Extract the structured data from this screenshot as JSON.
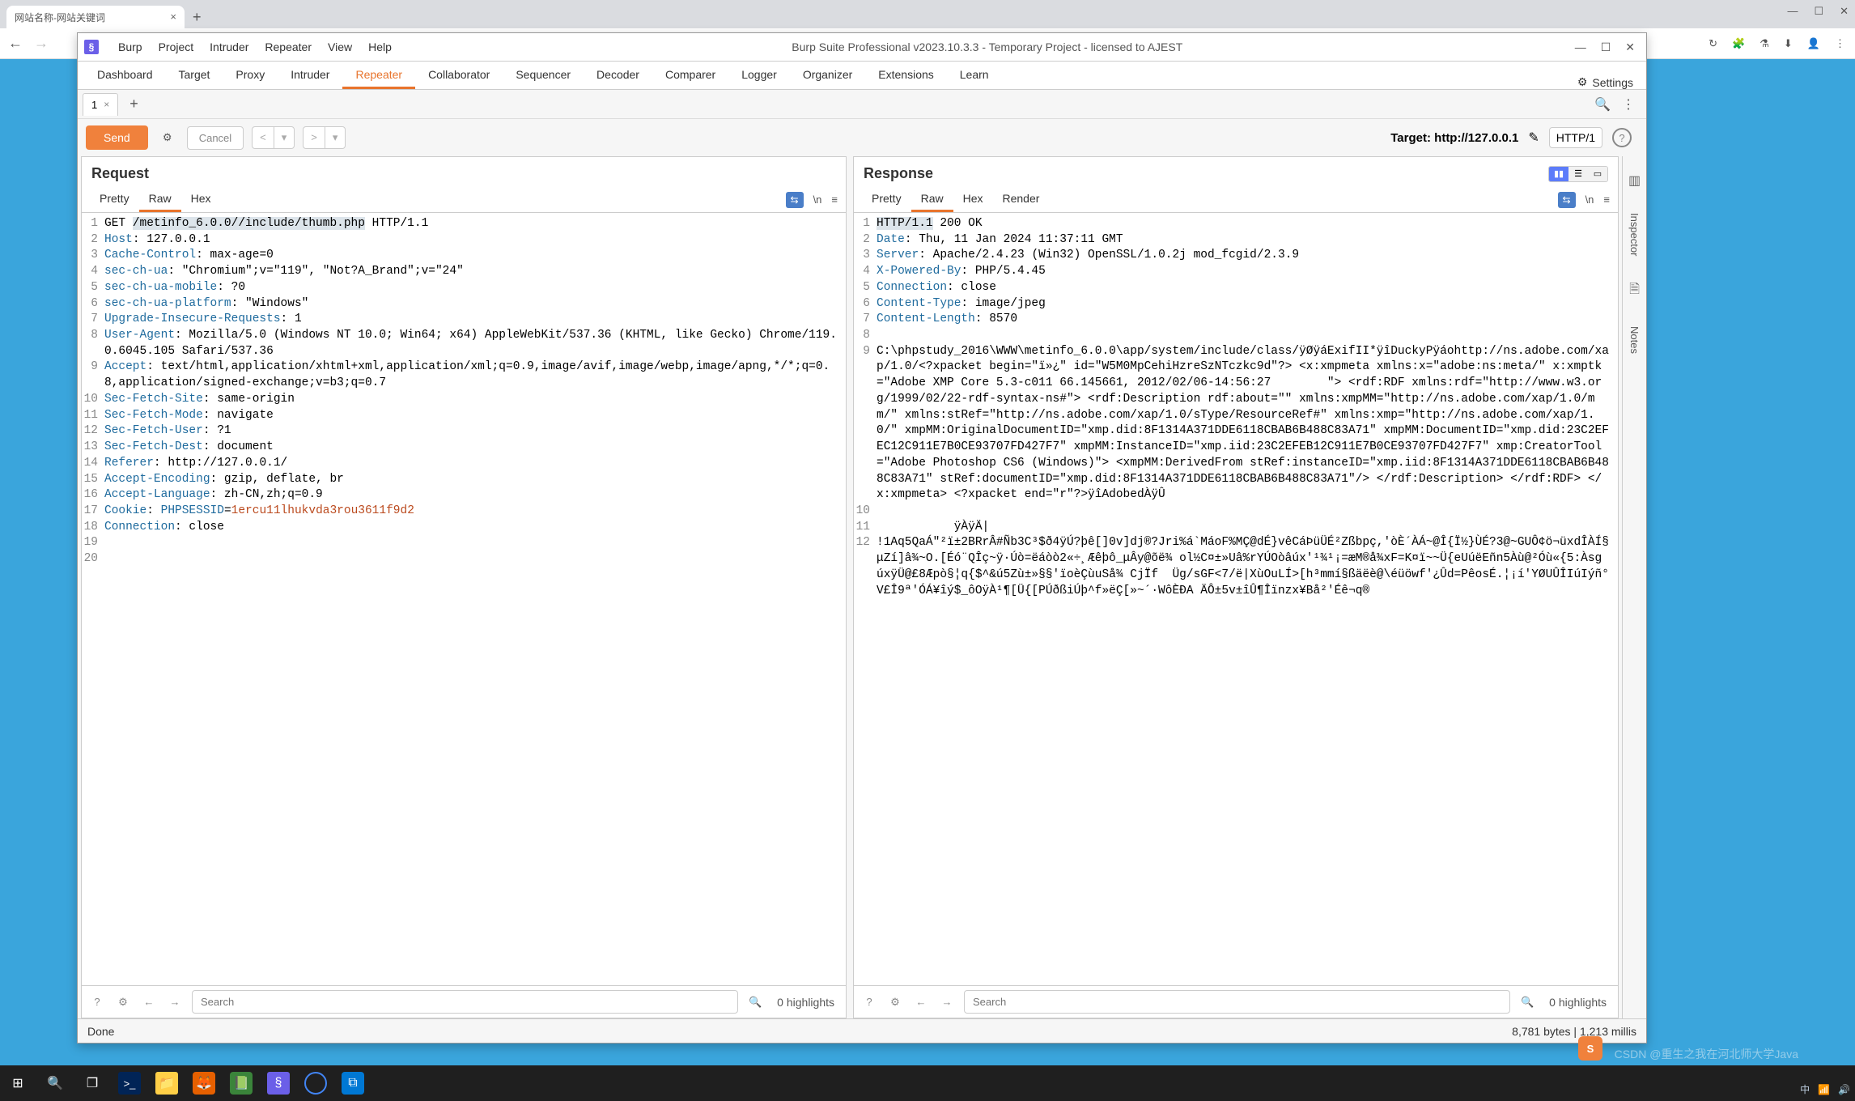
{
  "browser": {
    "tab_title": "网站名称-网站关键词",
    "toolbar_right_icons": [
      "puzzle",
      "flask",
      "download",
      "avatar",
      "kebab"
    ]
  },
  "burp": {
    "menus": [
      "Burp",
      "Project",
      "Intruder",
      "Repeater",
      "View",
      "Help"
    ],
    "title": "Burp Suite Professional v2023.10.3.3 - Temporary Project - licensed to AJEST",
    "tabs": [
      "Dashboard",
      "Target",
      "Proxy",
      "Intruder",
      "Repeater",
      "Collaborator",
      "Sequencer",
      "Decoder",
      "Comparer",
      "Logger",
      "Organizer",
      "Extensions",
      "Learn"
    ],
    "active_tab": "Repeater",
    "settings_label": "Settings",
    "sub_tab_label": "1",
    "send_label": "Send",
    "cancel_label": "Cancel",
    "target_prefix": "Target: ",
    "target_value": "http://127.0.0.1",
    "http_version": "HTTP/1",
    "side_labels": {
      "inspector": "Inspector",
      "notes": "Notes"
    }
  },
  "request": {
    "title": "Request",
    "tabs": [
      "Pretty",
      "Raw",
      "Hex"
    ],
    "active_tab": "Raw",
    "lines": [
      {
        "n": 1,
        "pre": "GET ",
        "hl": "/metinfo_6.0.0//include/thumb.php",
        "post": " HTTP/1.1"
      },
      {
        "n": 2,
        "k": "Host",
        "v": "127.0.0.1"
      },
      {
        "n": 3,
        "k": "Cache-Control",
        "v": "max-age=0"
      },
      {
        "n": 4,
        "k": "sec-ch-ua",
        "v": "\"Chromium\";v=\"119\", \"Not?A_Brand\";v=\"24\""
      },
      {
        "n": 5,
        "k": "sec-ch-ua-mobile",
        "v": "?0"
      },
      {
        "n": 6,
        "k": "sec-ch-ua-platform",
        "v": "\"Windows\""
      },
      {
        "n": 7,
        "k": "Upgrade-Insecure-Requests",
        "v": "1"
      },
      {
        "n": 8,
        "k": "User-Agent",
        "v": "Mozilla/5.0 (Windows NT 10.0; Win64; x64) AppleWebKit/537.36 (KHTML, like Gecko) Chrome/119.0.6045.105 Safari/537.36"
      },
      {
        "n": 9,
        "k": "Accept",
        "v": "text/html,application/xhtml+xml,application/xml;q=0.9,image/avif,image/webp,image/apng,*/*;q=0.8,application/signed-exchange;v=b3;q=0.7"
      },
      {
        "n": 10,
        "k": "Sec-Fetch-Site",
        "v": "same-origin"
      },
      {
        "n": 11,
        "k": "Sec-Fetch-Mode",
        "v": "navigate"
      },
      {
        "n": 12,
        "k": "Sec-Fetch-User",
        "v": "?1"
      },
      {
        "n": 13,
        "k": "Sec-Fetch-Dest",
        "v": "document"
      },
      {
        "n": 14,
        "k": "Referer",
        "v": "http://127.0.0.1/"
      },
      {
        "n": 15,
        "k": "Accept-Encoding",
        "v": "gzip, deflate, br"
      },
      {
        "n": 16,
        "k": "Accept-Language",
        "v": "zh-CN,zh;q=0.9"
      },
      {
        "n": 17,
        "k": "Cookie",
        "kk": "PHPSESSID",
        "vv": "1ercu11lhukvda3rou3611f9d2"
      },
      {
        "n": 18,
        "k": "Connection",
        "v": "close"
      },
      {
        "n": 19,
        "raw": ""
      },
      {
        "n": 20,
        "raw": ""
      }
    ],
    "highlights": "0 highlights",
    "search_ph": "Search"
  },
  "response": {
    "title": "Response",
    "tabs": [
      "Pretty",
      "Raw",
      "Hex",
      "Render"
    ],
    "active_tab": "Raw",
    "lines": [
      {
        "n": 1,
        "pre": "",
        "hl": "HTTP/1.1",
        "post": " 200 OK"
      },
      {
        "n": 2,
        "k": "Date",
        "v": "Thu, 11 Jan 2024 11:37:11 GMT"
      },
      {
        "n": 3,
        "k": "Server",
        "v": "Apache/2.4.23 (Win32) OpenSSL/1.0.2j mod_fcgid/2.3.9"
      },
      {
        "n": 4,
        "k": "X-Powered-By",
        "v": "PHP/5.4.45"
      },
      {
        "n": 5,
        "k": "Connection",
        "v": "close"
      },
      {
        "n": 6,
        "k": "Content-Type",
        "v": "image/jpeg"
      },
      {
        "n": 7,
        "k": "Content-Length",
        "v": "8570"
      },
      {
        "n": 8,
        "raw": ""
      },
      {
        "n": 9,
        "raw": "C:\\phpstudy_2016\\WWW\\metinfo_6.0.0\\app/system/include/class/ÿØÿáExifII*ÿîDuckyPÿáohttp://ns.adobe.com/xap/1.0/<?xpacket begin=\"ï»¿\" id=\"W5M0MpCehiHzreSzNTczkc9d\"?> <x:xmpmeta xmlns:x=\"adobe:ns:meta/\" x:xmptk=\"Adobe XMP Core 5.3-c011 66.145661, 2012/02/06-14:56:27        \"> <rdf:RDF xmlns:rdf=\"http://www.w3.org/1999/02/22-rdf-syntax-ns#\"> <rdf:Description rdf:about=\"\" xmlns:xmpMM=\"http://ns.adobe.com/xap/1.0/mm/\" xmlns:stRef=\"http://ns.adobe.com/xap/1.0/sType/ResourceRef#\" xmlns:xmp=\"http://ns.adobe.com/xap/1.0/\" xmpMM:OriginalDocumentID=\"xmp.did:8F1314A371DDE6118CBAB6B488C83A71\" xmpMM:DocumentID=\"xmp.did:23C2EFEC12C911E7B0CE93707FD427F7\" xmpMM:InstanceID=\"xmp.iid:23C2EFEB12C911E7B0CE93707FD427F7\" xmp:CreatorTool=\"Adobe Photoshop CS6 (Windows)\"> <xmpMM:DerivedFrom stRef:instanceID=\"xmp.iid:8F1314A371DDE6118CBAB6B488C83A71\" stRef:documentID=\"xmp.did:8F1314A371DDE6118CBAB6B488C83A71\"/> </rdf:Description> </rdf:RDF> </x:xmpmeta> <?xpacket end=\"r\"?>ÿîAdobedÀÿÛ"
      },
      {
        "n": 10,
        "raw": ""
      },
      {
        "n": 11,
        "raw": "           ÿÀÿÄ|"
      },
      {
        "n": 12,
        "raw": "!1Aq5QaÁ\"²ï±2BRrÂ#Ñb3C³$ð4ÿÚ?þê[]0v]dj®?Jri%á`MáoF%MÇ@dÉ}vêCáÞüÜÉ²Zßbpç,'òÈ´ÀÁ~@Î{Ï½}ÙÉ?3@~GUÔ¢ö¬üxdÎÀÍ§μZí]â¾~O.[Éó¨QÎç~ÿ·Úò=ëáòò2«÷¸Æêþô_μÂy@õë¾ ol½C¤±»Uâ%rYÚOòâúx'¹¾¹¡=æM®å¾xF=K¤ï~~Ü{eUúëEñn5Àù@²Óù«{5:Àsg  úxÿÜ@£8Æpò§¦q{$^&ú5Zù±»§§'ïoèÇùuSå¾ CjÏf  Üg/sGF<7/ë|XùOuLÍ>[h³mmí§ßäëè@\\éüöwf'¿Ûd=PêosÉ.¦¡í'YØUÛÎIúIýñ°V£Î9ª'ÓÁ¥îý$_ôOÿÀ¹¶[Ü{[PÚðßiÚþ^f»ëÇ[»~´·WôÈÐA ÄÔ±5v±îÛ¶Îïnzx¥Bå²'Éê¬q®"
      }
    ],
    "highlights": "0 highlights",
    "search_ph": "Search"
  },
  "status": {
    "left": "Done",
    "right": "8,781 bytes | 1,213 millis"
  },
  "watermark": "CSDN @重生之我在河北师大学Java"
}
